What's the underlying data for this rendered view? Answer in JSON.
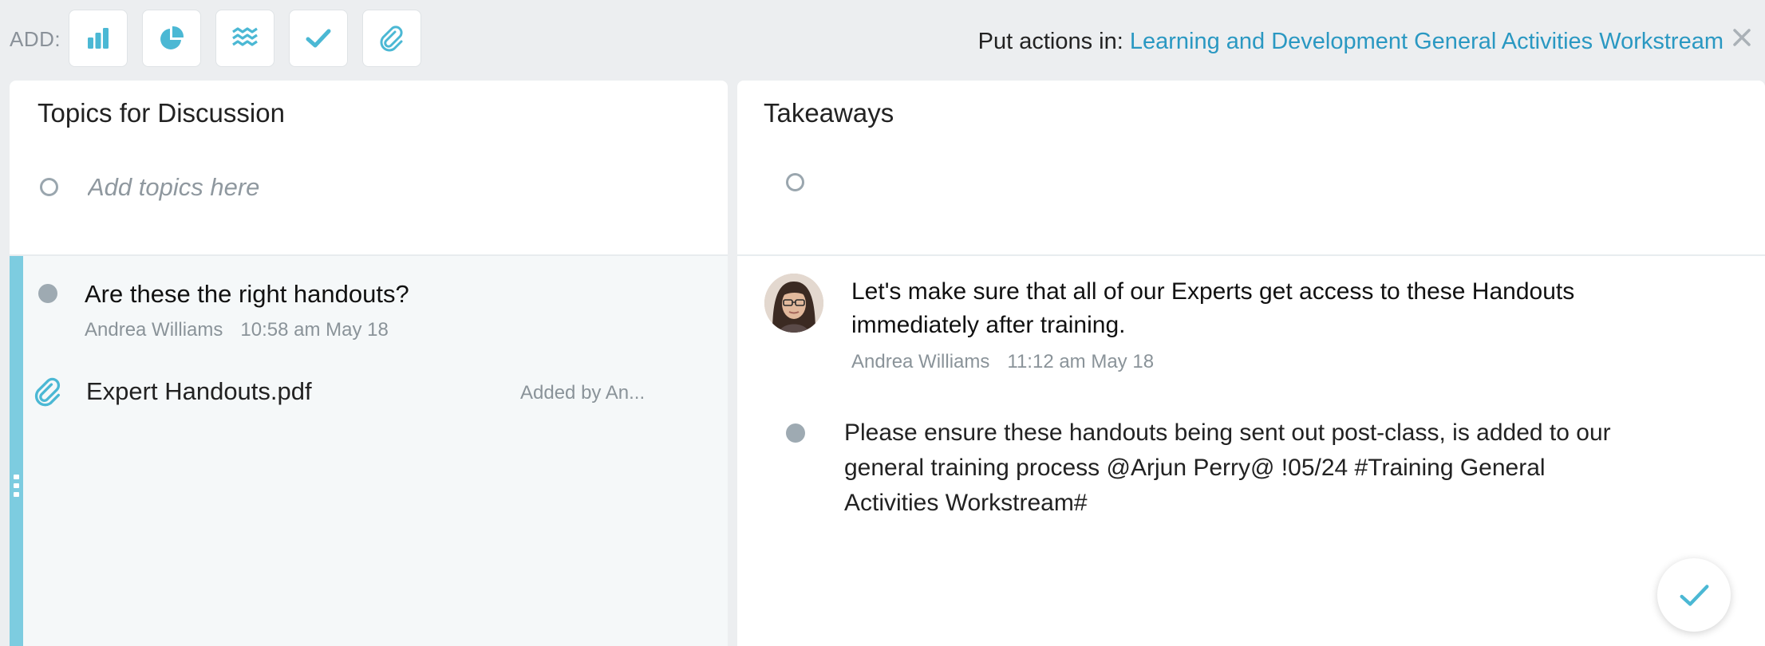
{
  "toolbar": {
    "add_label": "ADD:",
    "buttons": [
      {
        "name": "bar-chart-icon"
      },
      {
        "name": "pie-chart-icon"
      },
      {
        "name": "waves-icon"
      },
      {
        "name": "checkmark-icon"
      },
      {
        "name": "paperclip-icon"
      }
    ],
    "put_actions_label": "Put actions in:",
    "workstream_link": "Learning and Development General Activities Workstream",
    "accent_color": "#4bb8d4",
    "link_color": "#2a98c2"
  },
  "topics": {
    "title": "Topics for Discussion",
    "add_placeholder": "Add topics here",
    "items": [
      {
        "title": "Are these the right handouts?",
        "author": "Andrea Williams",
        "time": "10:58 am May 18"
      }
    ],
    "attachment": {
      "name": "Expert Handouts.pdf",
      "added_by": "Added by An..."
    }
  },
  "takeaways": {
    "title": "Takeaways",
    "note": {
      "text": "Let's make sure that all of our Experts get access to these Handouts immediately after training.",
      "author": "Andrea Williams",
      "time": "11:12 am May 18"
    },
    "action": {
      "text": "Please ensure these handouts being sent out post-class, is added to our general training process @Arjun Perry@ !05/24 #Training General Activities Workstream#"
    }
  }
}
